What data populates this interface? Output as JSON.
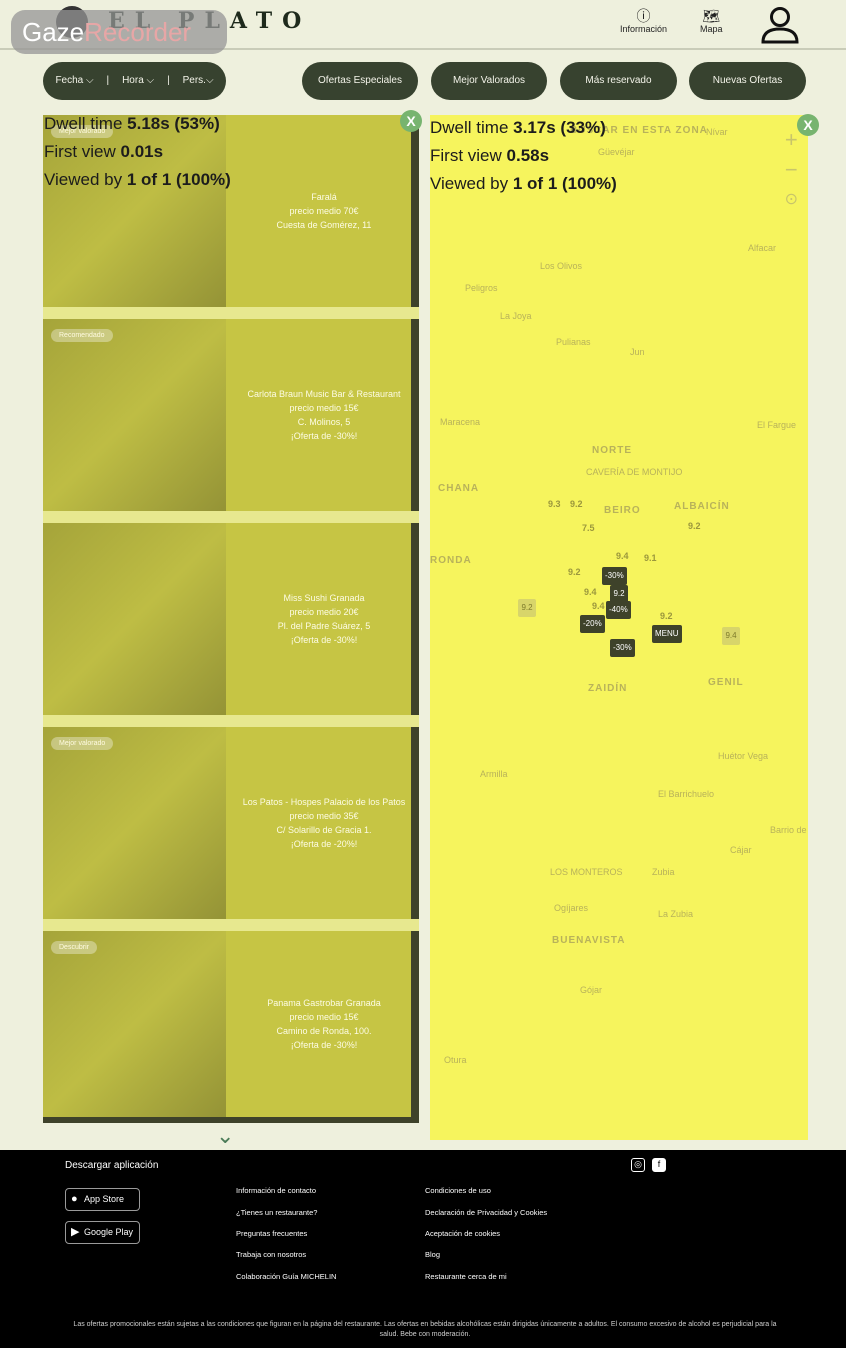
{
  "gaze_badge": {
    "part1": "Gaze",
    "part2": "Recorder"
  },
  "header": {
    "brand": "EL PLATO",
    "info_label": "Información",
    "map_label": "Mapa"
  },
  "filters": {
    "fecha": "Fecha",
    "hora": "Hora",
    "pers": "Pers."
  },
  "tabs": [
    "Ofertas Especiales",
    "Mejor Valorados",
    "Más reservado",
    "Nuevas Ofertas"
  ],
  "restaurants": [
    {
      "tag": "Mejor valorado",
      "name": "Faralá",
      "price": "precio medio 70€",
      "address": "Cuesta de Gomérez, 11",
      "offer": ""
    },
    {
      "tag": "Recomendado",
      "name": "Carlota Braun Music Bar & Restaurant",
      "price": "precio medio 15€",
      "address": "C. Molinos, 5",
      "offer": "¡Oferta de -30%!"
    },
    {
      "tag": "",
      "name": "Miss Sushi Granada",
      "price": "precio medio 20€",
      "address": "Pl. del Padre Suárez, 5",
      "offer": "¡Oferta de -30%!"
    },
    {
      "tag": "Mejor valorado",
      "name": "Los Patos - Hospes Palacio de los Patos",
      "price": "precio medio 35€",
      "address": "C/ Solarillo de Gracia 1.",
      "offer": "¡Oferta de -20%!"
    },
    {
      "tag": "Descubrir",
      "name": "Panama Gastrobar Granada",
      "price": "precio medio 15€",
      "address": "Camino de Ronda, 100.",
      "offer": "¡Oferta de -30%!"
    }
  ],
  "gaze_stats": {
    "list": {
      "dwell_label": "Dwell time",
      "dwell": "5.18s (53%)",
      "first_label": "First view",
      "first": "0.01s",
      "viewed_label": "Viewed by",
      "viewed": "1 of 1 (100%)"
    },
    "map": {
      "dwell_label": "Dwell time",
      "dwell": "3.17s (33%)",
      "first_label": "First view",
      "first": "0.58s",
      "viewed_label": "Viewed by",
      "viewed": "1 of 1 (100%)"
    },
    "close_glyph": "X"
  },
  "map": {
    "labels": [
      "BUSCAR EN ESTA ZONA",
      "Güevéjar",
      "Nívar",
      "Alfacar",
      "Los Olivos",
      "Peligros",
      "La Joya",
      "Pulianas",
      "Jun",
      "Maracena",
      "El Fargue",
      "NORTE",
      "CAVERÍA DE MONTIJO",
      "CHANA",
      "BEIRO",
      "ALBAICÍN",
      "RONDA",
      "ZAIDÍN",
      "GENIL",
      "Huétor Vega",
      "Armilla",
      "El Barrichuelo",
      "Cájar",
      "Barrio de la Vega",
      "Zubia",
      "LOS MONTEROS",
      "Ogíjares",
      "La Zubia",
      "BUENAVISTA",
      "Gójar",
      "Otura"
    ],
    "pins": [
      "-30%",
      "9.2",
      "-40%",
      "-20%",
      "-30%",
      "MENU",
      "9.4",
      "9.2"
    ],
    "scores": [
      "9.3",
      "9.2",
      "7.5",
      "9.4",
      "9.1",
      "9.2",
      "9.2",
      "9.4",
      "9.4",
      "9.2"
    ]
  },
  "footer": {
    "download_title": "Descargar aplicación",
    "app_store": "App Store",
    "google_play": "Google Play",
    "col1": [
      "Información de contacto",
      "¿Tienes un restaurante?",
      "Preguntas frecuentes",
      "Trabaja con nosotros",
      "Colaboración Guía MICHELIN"
    ],
    "col2": [
      "Condiciones de uso",
      "Declaración de Privacidad y Cookies",
      "Aceptación de cookies",
      "Blog",
      "Restaurante cerca de mi"
    ],
    "legal": "Las ofertas promocionales están sujetas a las condiciones que figuran en la página del restaurante. Las ofertas en bebidas alcohólicas están dirigidas únicamente a adultos. El consumo excesivo de alcohol es perjudicial para la salud. Bebe con moderación."
  },
  "colors": {
    "heatmap_list": "#c6c544",
    "heatmap_map": "#f6f45d",
    "pill": "#37422f",
    "close": "#77b46f"
  }
}
